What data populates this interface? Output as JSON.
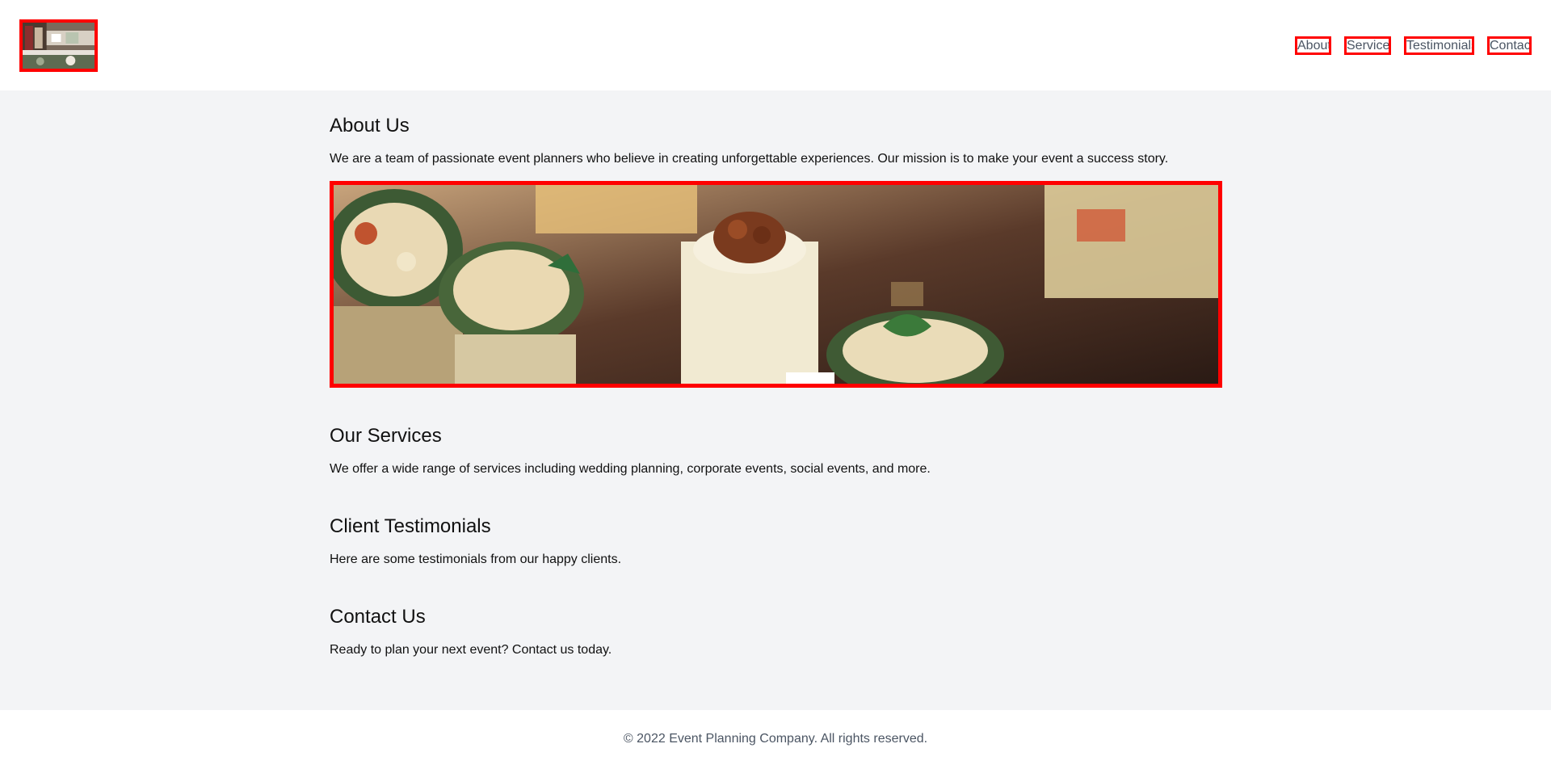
{
  "header": {
    "logo_icon": "event-table-photo",
    "nav": [
      {
        "label": "About"
      },
      {
        "label": "Services"
      },
      {
        "label": "Testimonials"
      },
      {
        "label": "Contact"
      }
    ]
  },
  "about": {
    "title": "About Us",
    "text": "We are a team of passionate event planners who believe in creating unforgettable experiences. Our mission is to make your event a success story.",
    "image_icon": "catering-appetizers-photo"
  },
  "services": {
    "title": "Our Services",
    "text": "We offer a wide range of services including wedding planning, corporate events, social events, and more."
  },
  "testimonials": {
    "title": "Client Testimonials",
    "text": "Here are some testimonials from our happy clients."
  },
  "contact": {
    "title": "Contact Us",
    "text": "Ready to plan your next event? Contact us today."
  },
  "footer": {
    "copyright": "© 2022 Event Planning Company. All rights reserved."
  },
  "colors": {
    "highlight_border": "#ff0000",
    "page_background": "#f3f4f6",
    "nav_text": "#4b5563"
  }
}
